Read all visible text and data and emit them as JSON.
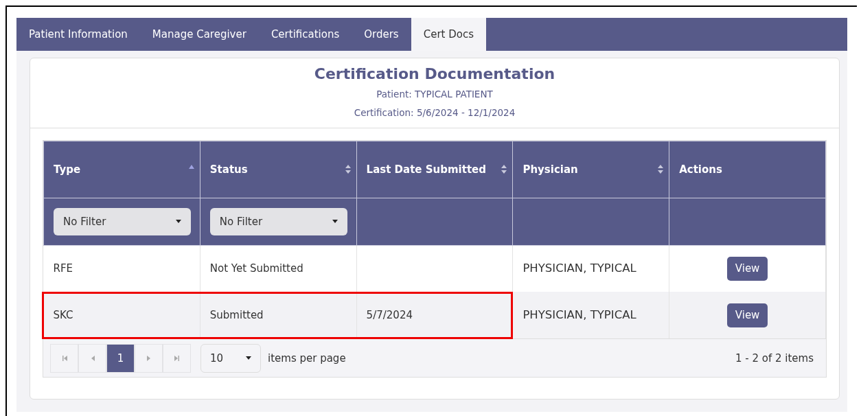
{
  "tabs": [
    {
      "label": "Patient Information",
      "selected": false
    },
    {
      "label": "Manage Caregiver",
      "selected": false
    },
    {
      "label": "Certifications",
      "selected": false
    },
    {
      "label": "Orders",
      "selected": false
    },
    {
      "label": "Cert Docs",
      "selected": true
    }
  ],
  "header": {
    "title": "Certification Documentation",
    "patient": "Patient: TYPICAL PATIENT",
    "certification": "Certification: 5/6/2024 - 12/1/2024"
  },
  "table": {
    "columns": [
      {
        "label": "Type",
        "sortable": true,
        "sorted_ascending": true,
        "filter": "No Filter"
      },
      {
        "label": "Status",
        "sortable": true,
        "sorted_ascending": false,
        "filter": "No Filter"
      },
      {
        "label": "Last Date Submitted",
        "sortable": true,
        "sorted_ascending": false
      },
      {
        "label": "Physician",
        "sortable": true,
        "sorted_ascending": false
      },
      {
        "label": "Actions",
        "sortable": false
      }
    ],
    "rows": [
      {
        "cells": [
          "RFE",
          "Not Yet Submitted",
          "",
          "PHYSICIAN, TYPICAL"
        ],
        "action": "View",
        "highlighted": false
      },
      {
        "cells": [
          "SKC",
          "Submitted",
          "5/7/2024",
          "PHYSICIAN, TYPICAL"
        ],
        "action": "View",
        "highlighted": true
      }
    ]
  },
  "pager": {
    "pages": [
      {
        "label": "1",
        "selected": true
      }
    ],
    "page_size": "10",
    "page_size_label": "items per page",
    "summary": "1 - 2 of 2 items"
  }
}
